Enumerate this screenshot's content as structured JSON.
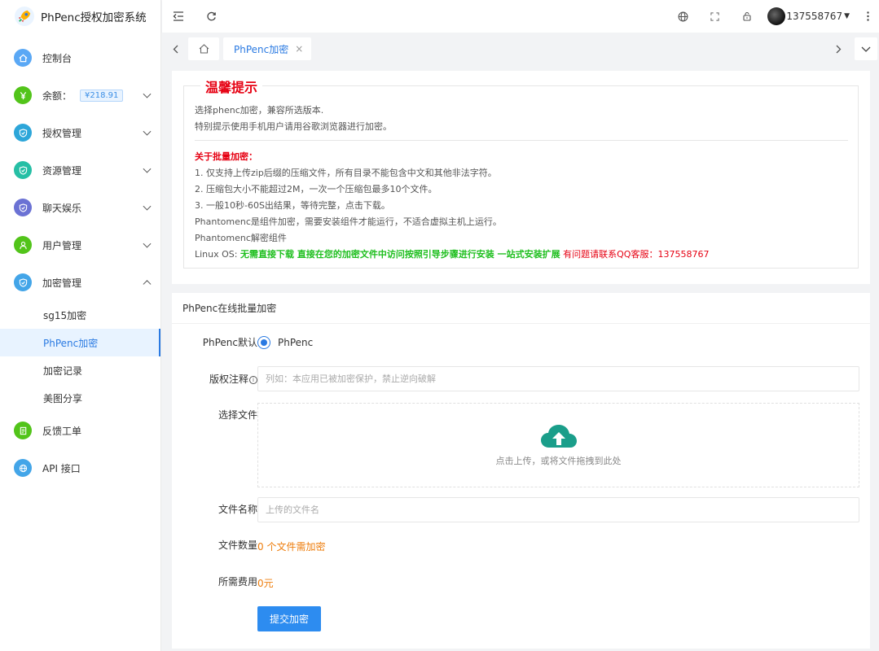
{
  "brand": {
    "title": "PhPenc授权加密系统",
    "logo_icon": "rocket-icon"
  },
  "sidebar": {
    "items": [
      {
        "label": "控制台",
        "icon": "home-icon",
        "color": "#5aa8f5",
        "expandable": false
      },
      {
        "label": "余额：",
        "icon": "yen-icon",
        "color": "#52c41a",
        "expandable": true,
        "badge": "¥218.91"
      },
      {
        "label": "授权管理",
        "icon": "shield-icon",
        "color": "#2da6d9",
        "expandable": true
      },
      {
        "label": "资源管理",
        "icon": "shield-icon",
        "color": "#26bfa5",
        "expandable": true
      },
      {
        "label": "聊天娱乐",
        "icon": "shield-icon",
        "color": "#6b72d4",
        "expandable": true
      },
      {
        "label": "用户管理",
        "icon": "user-icon",
        "color": "#52c41a",
        "expandable": true
      },
      {
        "label": "加密管理",
        "icon": "shield-icon",
        "color": "#43a5e8",
        "expandable": true,
        "expanded": true,
        "children": [
          {
            "label": "sg15加密"
          },
          {
            "label": "PhPenc加密",
            "active": true
          },
          {
            "label": "加密记录"
          },
          {
            "label": "美图分享"
          }
        ]
      },
      {
        "label": "反馈工单",
        "icon": "doc-icon",
        "color": "#52c41a",
        "expandable": false
      },
      {
        "label": "API 接口",
        "icon": "globe-icon",
        "color": "#43a5e8",
        "expandable": false
      }
    ]
  },
  "topbar": {
    "username": "137558767"
  },
  "tabs": {
    "items": [
      {
        "label": "PhPenc加密",
        "close": "×"
      }
    ]
  },
  "notice": {
    "title": "温馨提示",
    "line1": "选择phenc加密，兼容所选版本.",
    "line2": "特别提示使用手机用户请用谷歌浏览器进行加密。",
    "batch_title": "关于批量加密：",
    "rule1": "1. 仅支持上传zip后缀的压缩文件，所有目录不能包含中文和其他非法字符。",
    "rule2": "2. 压缩包大小不能超过2M，一次一个压缩包最多10个文件。",
    "rule3": "3. 一般10秒-60S出结果，等待完整，点击下载。",
    "phantom1": "Phantomenc是组件加密，需要安装组件才能运行，不适合虚拟主机上运行。",
    "phantom2": "Phantomenc解密组件",
    "linux_prefix": "Linux OS: ",
    "linux_green": "无需直接下载 直接在您的加密文件中访问按照引导步骤进行安装 一站式安装扩展",
    "linux_red": " 有问题请联系QQ客服：137558767"
  },
  "form": {
    "header": "PhPenc在线批量加密",
    "default_label": "PhPenc默认",
    "default_option": "PhPenc",
    "copyright_label": "版权注释",
    "copyright_placeholder": "列如：本应用已被加密保护，禁止逆向破解",
    "file_label": "选择文件",
    "upload_text": "点击上传，或将文件拖拽到此处",
    "filename_label": "文件名称",
    "filename_placeholder": "上传的文件名",
    "count_label": "文件数量",
    "count_value": "0 个文件需加密",
    "fee_label": "所需费用",
    "fee_value": "0元",
    "submit": "提交加密"
  },
  "colors": {
    "primary": "#2d8cf0",
    "danger": "#e60012",
    "success": "#1fbf1f",
    "warning": "#ee7d0c",
    "upload_icon": "#1a9e8a"
  }
}
